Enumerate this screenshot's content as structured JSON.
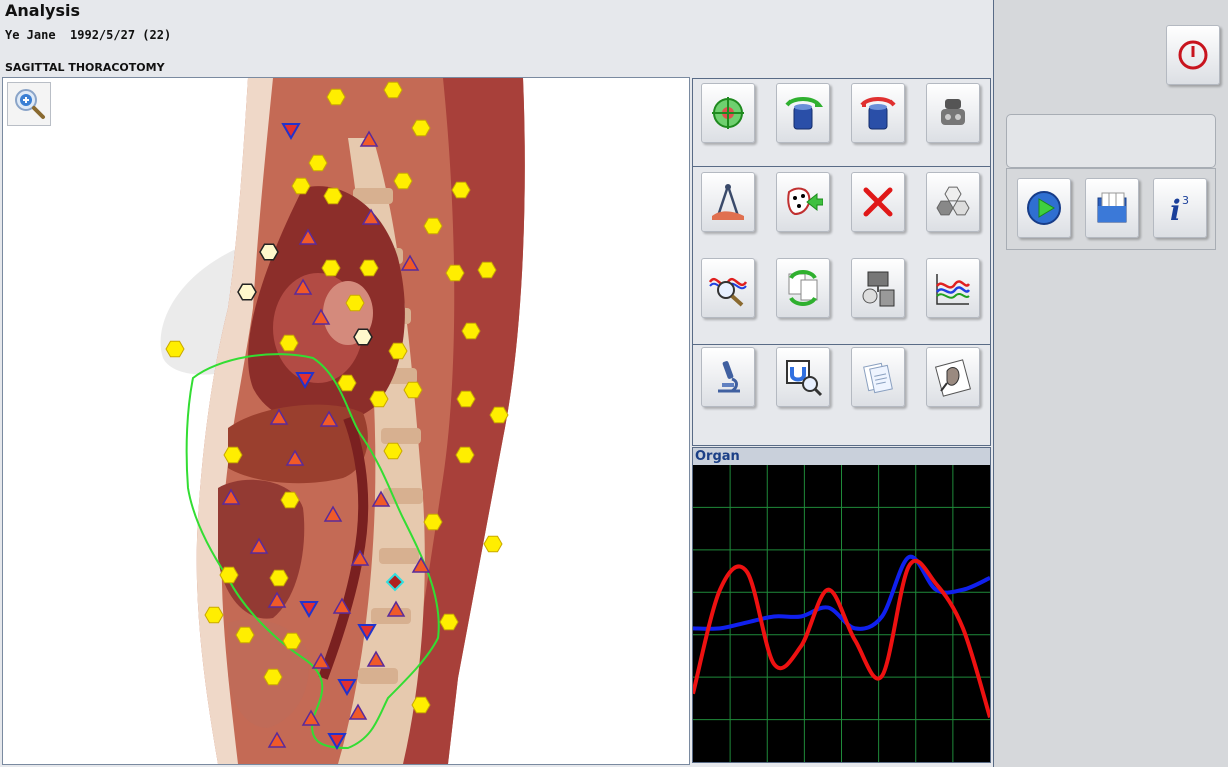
{
  "header": {
    "title": "Analysis",
    "patient_name": "Ye Jane",
    "patient_dob_age": "1992/5/27 (22)",
    "view_label": "SAGITTAL THORACOTOMY"
  },
  "toolbar": {
    "rows": [
      [
        "target-icon",
        "rotate-left-icon",
        "rotate-right-icon",
        "organ-parts-icon"
      ],
      [
        "compass-icon",
        "selection-arrow-icon",
        "delete-icon",
        "hexagon-cluster-icon"
      ],
      [
        "wave-search-icon",
        "cycle-docs-icon",
        "image-compare-icon",
        "multi-wave-icon"
      ],
      [
        "microscope-icon",
        "zoom-magnet-icon",
        "documents-icon",
        "anatomy-book-icon"
      ]
    ]
  },
  "organ_panel": {
    "title": "Organ"
  },
  "right_panel": {
    "buttons": [
      "power-icon",
      "play-icon",
      "folders-icon",
      "info-icon"
    ]
  },
  "colors": {
    "marker_yellow": "#ffee00",
    "marker_orange_triangle": "#f05a28",
    "marker_blue_triangle": "#2233cc",
    "outline_green": "#33dd33",
    "series_red": "#ee1111",
    "series_blue": "#1020ee",
    "grid": "#1f8a3a"
  },
  "chart_data": {
    "type": "line",
    "title": "Organ",
    "grid": true,
    "series": [
      {
        "color": "#ee1111",
        "values": [
          0.77,
          0.42,
          0.36,
          0.67,
          0.61,
          0.42,
          0.59,
          0.71,
          0.34,
          0.4,
          0.55,
          0.85
        ]
      },
      {
        "color": "#1020ee",
        "values": [
          0.55,
          0.55,
          0.53,
          0.51,
          0.51,
          0.48,
          0.55,
          0.51,
          0.31,
          0.42,
          0.42,
          0.38
        ]
      }
    ]
  }
}
